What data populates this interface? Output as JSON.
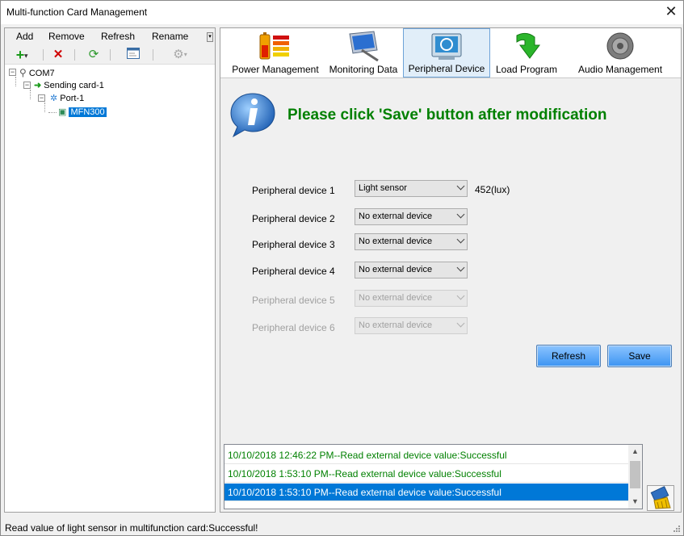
{
  "window": {
    "title": "Multi-function Card Management",
    "close_glyph": "✕"
  },
  "menu": {
    "add": "Add",
    "remove": "Remove",
    "refresh": "Refresh",
    "rename": "Rename"
  },
  "tree": {
    "root": "COM7",
    "sending_card": "Sending card-1",
    "port": "Port-1",
    "device": "MFN300"
  },
  "tabs": [
    {
      "label": "Power Management",
      "icon": "battery-icon"
    },
    {
      "label": "Monitoring Data",
      "icon": "monitor-icon"
    },
    {
      "label": "Peripheral Device",
      "icon": "device-icon"
    },
    {
      "label": "Load Program",
      "icon": "download-icon"
    },
    {
      "label": "Audio Management",
      "icon": "speaker-icon"
    }
  ],
  "notice": "Please click 'Save' button after modification",
  "peripherals": [
    {
      "label": "Peripheral device 1",
      "value": "Light sensor",
      "enabled": true
    },
    {
      "label": "Peripheral device 2",
      "value": "No external device",
      "enabled": true
    },
    {
      "label": "Peripheral device 3",
      "value": "No external device",
      "enabled": true
    },
    {
      "label": "Peripheral device 4",
      "value": "No external device",
      "enabled": true
    },
    {
      "label": "Peripheral device 5",
      "value": "No external device",
      "enabled": false
    },
    {
      "label": "Peripheral device 6",
      "value": "No external device",
      "enabled": false
    }
  ],
  "sensor_reading": "452(lux)",
  "buttons": {
    "refresh": "Refresh",
    "save": "Save"
  },
  "log": [
    "10/10/2018 12:46:22 PM--Read external device value:Successful",
    "10/10/2018 1:53:10 PM--Read external device value:Successful",
    "10/10/2018 1:53:10 PM--Read external device value:Successful"
  ],
  "status": "Read value of light sensor in multifunction card:Successful!",
  "colors": {
    "accent": "#0078d7",
    "notice": "#008000",
    "button": "#3c94f2"
  }
}
